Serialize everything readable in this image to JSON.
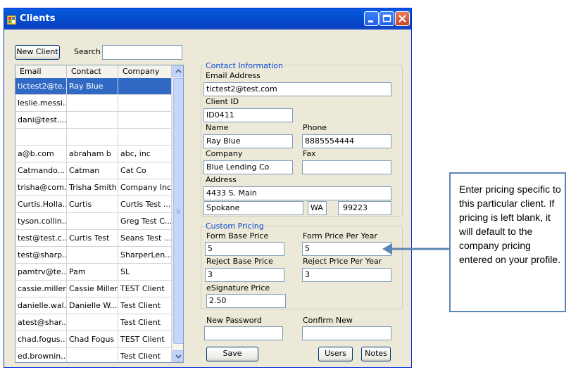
{
  "window": {
    "title": "Clients"
  },
  "toolbar": {
    "new_client_label": "New Client",
    "search_label": "Search",
    "search_value": ""
  },
  "grid": {
    "columns": [
      "Email",
      "Contact",
      "Company"
    ],
    "rows": [
      [
        "tictest2@te...",
        "Ray Blue",
        ""
      ],
      [
        "leslie.messi...",
        "",
        ""
      ],
      [
        "dani@test....",
        "",
        ""
      ],
      [
        "",
        "",
        ""
      ],
      [
        "a@b.com",
        "abraham b",
        "abc, inc"
      ],
      [
        "Catmando...",
        "Catman",
        "Cat Co"
      ],
      [
        "trisha@com...",
        "Trisha Smith",
        "Company Inc"
      ],
      [
        "Curtis.Holla...",
        "Curtis",
        "Curtis Test ..."
      ],
      [
        "tyson.collin...",
        "",
        "Greg Test C..."
      ],
      [
        "test@test.c...",
        "Curtis Test",
        "Seans Test ..."
      ],
      [
        "test@sharp...",
        "",
        "SharperLen..."
      ],
      [
        "pamtrv@te...",
        "Pam",
        "SL"
      ],
      [
        "cassie.miller...",
        "Cassie Miller",
        "TEST Client"
      ],
      [
        "danielle.wal...",
        "Danielle W...",
        "Test Client"
      ],
      [
        "atest@shar...",
        "",
        "Test Client"
      ],
      [
        "chad.fogus...",
        "Chad Fogus",
        "TEST Client"
      ],
      [
        "ed.brownin...",
        "",
        "Test Client"
      ]
    ]
  },
  "contact": {
    "legend": "Contact Information",
    "email_label": "Email Address",
    "email": "tictest2@test.com",
    "client_id_label": "Client ID",
    "client_id": "ID0411",
    "name_label": "Name",
    "name": "Ray Blue",
    "phone_label": "Phone",
    "phone": "8885554444",
    "company_label": "Company",
    "company": "Blue Lending Co",
    "fax_label": "Fax",
    "fax": "",
    "address_label": "Address",
    "address": "4433 S. Main",
    "city": "Spokane",
    "state": "WA",
    "zip": "99223"
  },
  "pricing": {
    "legend": "Custom Pricing",
    "form_base_label": "Form Base Price",
    "form_base": "5",
    "form_year_label": "Form Price Per Year",
    "form_year": "5",
    "reject_base_label": "Reject Base Price",
    "reject_base": "3",
    "reject_year_label": "Reject Price Per Year",
    "reject_year": "3",
    "esig_label": "eSignature Price",
    "esig": "2.50"
  },
  "password": {
    "new_label": "New Password",
    "new": "",
    "confirm_label": "Confirm New",
    "confirm": ""
  },
  "buttons": {
    "save": "Save",
    "users": "Users",
    "notes": "Notes"
  },
  "callout": {
    "text": "Enter pricing specific to this particular client.  If pricing is left blank, it will default to the company pricing entered on your profile."
  },
  "colors": {
    "title_bar": "#0351d0",
    "selection": "#316ac5",
    "group_legend": "#0046d5",
    "callout_border": "#5a86b5",
    "arrow": "#5a86b5"
  }
}
